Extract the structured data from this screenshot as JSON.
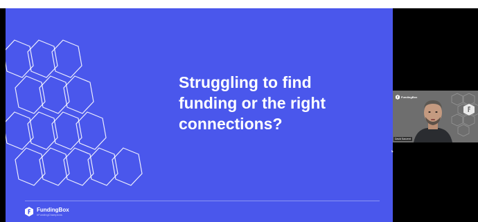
{
  "slide": {
    "headline_lines": [
      "Struggling to find",
      "funding or the right",
      "connections?"
    ],
    "brand_name": "FundingBox",
    "brand_tagline": "#FundingChampions",
    "background_color": "#4a57ec",
    "text_color": "#ffffff"
  },
  "webcam": {
    "logo_text": "FundingBox",
    "participant_name": "David Sanzent",
    "logo_icon": "funding-box-f-icon"
  }
}
